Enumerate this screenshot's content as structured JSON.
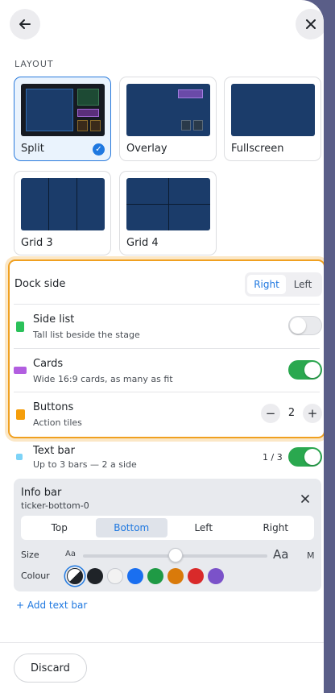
{
  "section_label": "LAYOUT",
  "layouts": [
    {
      "label": "Split",
      "selected": true
    },
    {
      "label": "Overlay",
      "selected": false
    },
    {
      "label": "Fullscreen",
      "selected": false
    },
    {
      "label": "Grid 3",
      "selected": false
    },
    {
      "label": "Grid 4",
      "selected": false
    }
  ],
  "dock": {
    "label": "Dock side",
    "options": [
      "Right",
      "Left"
    ],
    "selected": "Right"
  },
  "rows": {
    "side_list": {
      "title": "Side list",
      "subtitle": "Tall list beside the stage",
      "enabled": false,
      "color": "#2bc15a"
    },
    "cards": {
      "title": "Cards",
      "subtitle": "Wide 16:9 cards, as many as fit",
      "enabled": true,
      "color": "#b25ee0"
    },
    "buttons": {
      "title": "Buttons",
      "subtitle": "Action tiles",
      "count": "2",
      "minus": "−",
      "plus": "+",
      "color": "#f59e0b"
    },
    "text_bar": {
      "title": "Text bar",
      "subtitle": "Up to 3 bars — 2 a side",
      "count": "1 / 3",
      "enabled": true,
      "color": "#7dd3f7"
    }
  },
  "info_bar": {
    "title": "Info bar",
    "id": "ticker-bottom-0",
    "positions": [
      "Top",
      "Bottom",
      "Left",
      "Right"
    ],
    "selected_position": "Bottom",
    "size_label": "Size",
    "size_small": "Aa",
    "size_large": "Aa",
    "size_value_label": "M",
    "size_level": 0.5,
    "colour_label": "Colour",
    "colours": [
      "auto",
      "#1f2328",
      "#f2f2f2",
      "#1a6ff0",
      "#1f9a45",
      "#d97a0a",
      "#d92a2a",
      "#7b52c9"
    ]
  },
  "add_text_bar": "+ Add text bar",
  "discard": "Discard",
  "icons": {
    "back": "arrow-left-icon",
    "close": "close-icon",
    "check": "check-icon",
    "remove": "x-icon"
  }
}
